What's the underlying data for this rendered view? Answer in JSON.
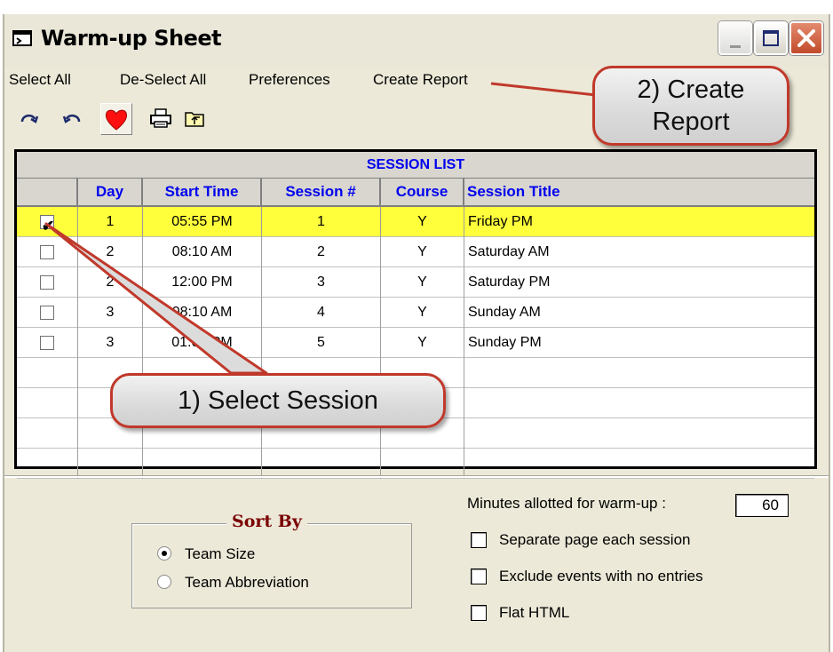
{
  "window": {
    "title": "Warm-up Sheet"
  },
  "menu": {
    "select_all": "Select All",
    "deselect_all": "De-Select All",
    "preferences": "Preferences",
    "create_report": "Create Report"
  },
  "toolbar": {
    "icons": [
      "redo-icon",
      "undo-icon",
      "heart-icon",
      "print-icon",
      "folder-up-icon"
    ]
  },
  "session_list": {
    "title": "SESSION LIST",
    "columns": [
      "Day",
      "Start Time",
      "Session #",
      "Course",
      "Session Title"
    ],
    "rows": [
      {
        "checked": true,
        "day": "1",
        "start_time": "05:55 PM",
        "session": "1",
        "course": "Y",
        "title": "Friday PM"
      },
      {
        "checked": false,
        "day": "2",
        "start_time": "08:10 AM",
        "session": "2",
        "course": "Y",
        "title": "Saturday AM"
      },
      {
        "checked": false,
        "day": "2",
        "start_time": "12:00 PM",
        "session": "3",
        "course": "Y",
        "title": "Saturday PM"
      },
      {
        "checked": false,
        "day": "3",
        "start_time": "08:10 AM",
        "session": "4",
        "course": "Y",
        "title": "Sunday AM"
      },
      {
        "checked": false,
        "day": "3",
        "start_time": "01:00 PM",
        "session": "5",
        "course": "Y",
        "title": "Sunday PM"
      }
    ]
  },
  "sort_by": {
    "legend": "Sort By",
    "options": [
      {
        "label": "Team Size",
        "selected": true
      },
      {
        "label": "Team Abbreviation",
        "selected": false
      }
    ]
  },
  "warmup": {
    "minutes_label": "Minutes allotted for warm-up :",
    "minutes_value": "60"
  },
  "options": [
    {
      "label": "Separate page each session",
      "checked": false
    },
    {
      "label": "Exclude events with no entries",
      "checked": false
    },
    {
      "label": "Flat HTML",
      "checked": false
    }
  ],
  "callouts": {
    "select_session": "1) Select Session",
    "create_report_line1": "2) Create",
    "create_report_line2": "Report"
  },
  "colors": {
    "header_text": "#0000ee",
    "selected_row": "#ffff3c",
    "callout_border": "#c0392b",
    "sort_legend": "#7a0000"
  }
}
